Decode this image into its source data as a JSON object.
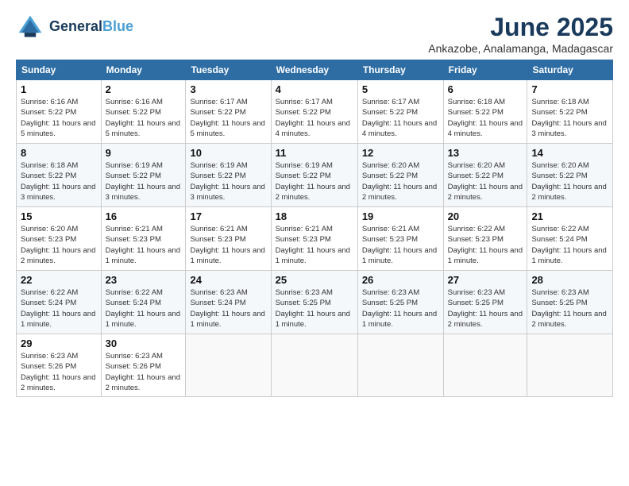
{
  "logo": {
    "line1": "General",
    "line2": "Blue"
  },
  "title": "June 2025",
  "location": "Ankazobe, Analamanga, Madagascar",
  "weekdays": [
    "Sunday",
    "Monday",
    "Tuesday",
    "Wednesday",
    "Thursday",
    "Friday",
    "Saturday"
  ],
  "weeks": [
    [
      {
        "day": "1",
        "sunrise": "6:16 AM",
        "sunset": "5:22 PM",
        "daylight": "11 hours and 5 minutes."
      },
      {
        "day": "2",
        "sunrise": "6:16 AM",
        "sunset": "5:22 PM",
        "daylight": "11 hours and 5 minutes."
      },
      {
        "day": "3",
        "sunrise": "6:17 AM",
        "sunset": "5:22 PM",
        "daylight": "11 hours and 5 minutes."
      },
      {
        "day": "4",
        "sunrise": "6:17 AM",
        "sunset": "5:22 PM",
        "daylight": "11 hours and 4 minutes."
      },
      {
        "day": "5",
        "sunrise": "6:17 AM",
        "sunset": "5:22 PM",
        "daylight": "11 hours and 4 minutes."
      },
      {
        "day": "6",
        "sunrise": "6:18 AM",
        "sunset": "5:22 PM",
        "daylight": "11 hours and 4 minutes."
      },
      {
        "day": "7",
        "sunrise": "6:18 AM",
        "sunset": "5:22 PM",
        "daylight": "11 hours and 3 minutes."
      }
    ],
    [
      {
        "day": "8",
        "sunrise": "6:18 AM",
        "sunset": "5:22 PM",
        "daylight": "11 hours and 3 minutes."
      },
      {
        "day": "9",
        "sunrise": "6:19 AM",
        "sunset": "5:22 PM",
        "daylight": "11 hours and 3 minutes."
      },
      {
        "day": "10",
        "sunrise": "6:19 AM",
        "sunset": "5:22 PM",
        "daylight": "11 hours and 3 minutes."
      },
      {
        "day": "11",
        "sunrise": "6:19 AM",
        "sunset": "5:22 PM",
        "daylight": "11 hours and 2 minutes."
      },
      {
        "day": "12",
        "sunrise": "6:20 AM",
        "sunset": "5:22 PM",
        "daylight": "11 hours and 2 minutes."
      },
      {
        "day": "13",
        "sunrise": "6:20 AM",
        "sunset": "5:22 PM",
        "daylight": "11 hours and 2 minutes."
      },
      {
        "day": "14",
        "sunrise": "6:20 AM",
        "sunset": "5:22 PM",
        "daylight": "11 hours and 2 minutes."
      }
    ],
    [
      {
        "day": "15",
        "sunrise": "6:20 AM",
        "sunset": "5:23 PM",
        "daylight": "11 hours and 2 minutes."
      },
      {
        "day": "16",
        "sunrise": "6:21 AM",
        "sunset": "5:23 PM",
        "daylight": "11 hours and 1 minute."
      },
      {
        "day": "17",
        "sunrise": "6:21 AM",
        "sunset": "5:23 PM",
        "daylight": "11 hours and 1 minute."
      },
      {
        "day": "18",
        "sunrise": "6:21 AM",
        "sunset": "5:23 PM",
        "daylight": "11 hours and 1 minute."
      },
      {
        "day": "19",
        "sunrise": "6:21 AM",
        "sunset": "5:23 PM",
        "daylight": "11 hours and 1 minute."
      },
      {
        "day": "20",
        "sunrise": "6:22 AM",
        "sunset": "5:23 PM",
        "daylight": "11 hours and 1 minute."
      },
      {
        "day": "21",
        "sunrise": "6:22 AM",
        "sunset": "5:24 PM",
        "daylight": "11 hours and 1 minute."
      }
    ],
    [
      {
        "day": "22",
        "sunrise": "6:22 AM",
        "sunset": "5:24 PM",
        "daylight": "11 hours and 1 minute."
      },
      {
        "day": "23",
        "sunrise": "6:22 AM",
        "sunset": "5:24 PM",
        "daylight": "11 hours and 1 minute."
      },
      {
        "day": "24",
        "sunrise": "6:23 AM",
        "sunset": "5:24 PM",
        "daylight": "11 hours and 1 minute."
      },
      {
        "day": "25",
        "sunrise": "6:23 AM",
        "sunset": "5:25 PM",
        "daylight": "11 hours and 1 minute."
      },
      {
        "day": "26",
        "sunrise": "6:23 AM",
        "sunset": "5:25 PM",
        "daylight": "11 hours and 1 minute."
      },
      {
        "day": "27",
        "sunrise": "6:23 AM",
        "sunset": "5:25 PM",
        "daylight": "11 hours and 2 minutes."
      },
      {
        "day": "28",
        "sunrise": "6:23 AM",
        "sunset": "5:25 PM",
        "daylight": "11 hours and 2 minutes."
      }
    ],
    [
      {
        "day": "29",
        "sunrise": "6:23 AM",
        "sunset": "5:26 PM",
        "daylight": "11 hours and 2 minutes."
      },
      {
        "day": "30",
        "sunrise": "6:23 AM",
        "sunset": "5:26 PM",
        "daylight": "11 hours and 2 minutes."
      },
      null,
      null,
      null,
      null,
      null
    ]
  ]
}
